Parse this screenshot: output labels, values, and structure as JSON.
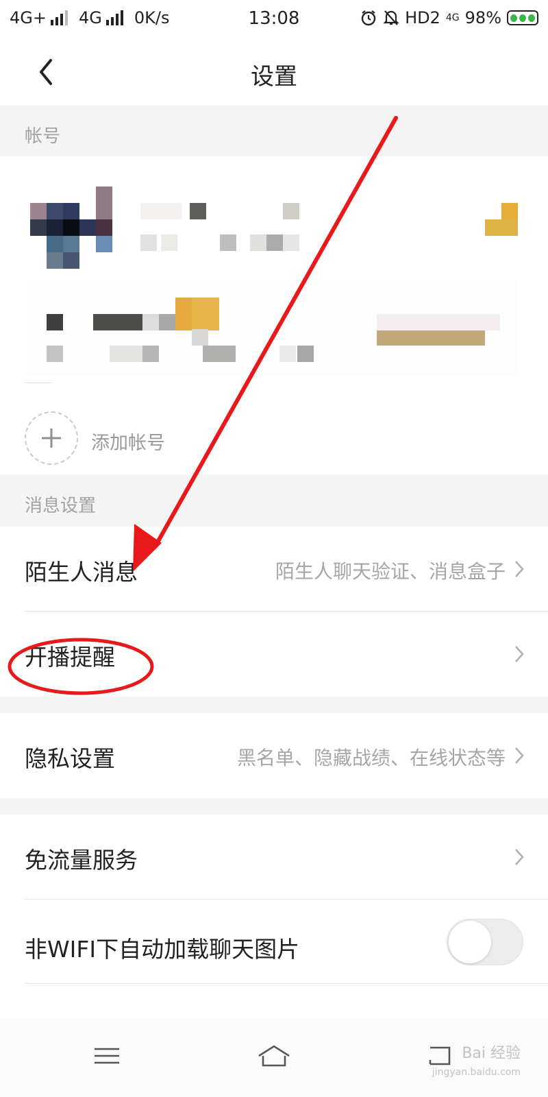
{
  "status_bar": {
    "network1": "4G+",
    "network2": "4G",
    "speed": "0K/s",
    "time": "13:08",
    "hd": "HD2",
    "net3": "4G",
    "battery_percent": "98%"
  },
  "header": {
    "title": "设置",
    "back_icon": "chevron-left-icon"
  },
  "account_section": {
    "header": "帐号",
    "add_account_label": "添加帐号"
  },
  "message_section": {
    "header": "消息设置",
    "items": [
      {
        "label": "陌生人消息",
        "hint": "陌生人聊天验证、消息盒子"
      },
      {
        "label": "开播提醒",
        "hint": ""
      }
    ]
  },
  "privacy": {
    "label": "隐私设置",
    "hint": "黑名单、隐藏战绩、在线状态等"
  },
  "data_section": {
    "items": [
      {
        "label": "免流量服务"
      },
      {
        "label": "非WIFI下自动加载聊天图片",
        "toggle_on": false
      }
    ]
  },
  "nav": {
    "icons": [
      "menu-icon",
      "home-icon",
      "back-icon"
    ]
  },
  "watermark": {
    "line1": "Bai 经验",
    "line2": "jingyan.baidu.com"
  },
  "colors": {
    "annotation_red": "#e8181b",
    "background": "#f4f4f4",
    "hint_gray": "#a6a6a6"
  }
}
